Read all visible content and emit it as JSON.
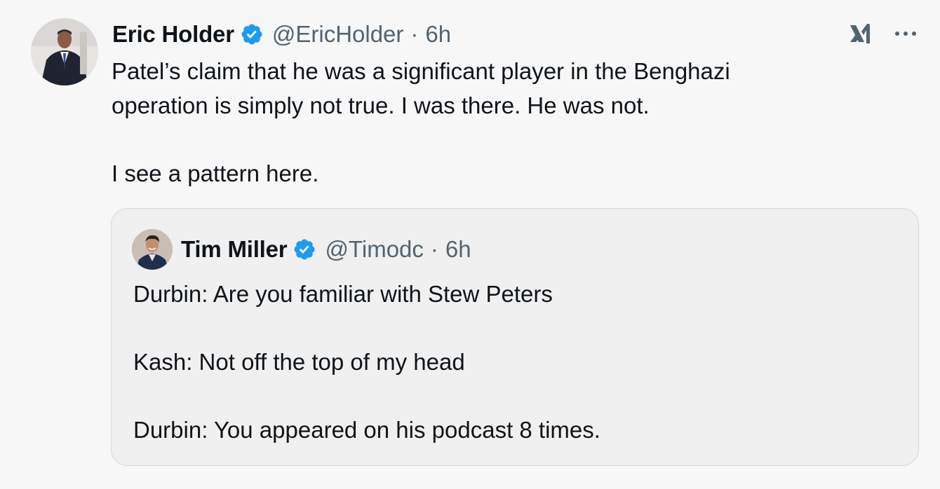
{
  "tweet": {
    "author_name": "Eric Holder",
    "handle": "@EricHolder",
    "separator": "·",
    "time": "6h",
    "verified": true,
    "body": {
      "line1": "Patel’s claim that he was a significant player in the Benghazi",
      "line2": "operation is simply not true.  I was there.  He was not.",
      "line3": "I see a pattern here."
    },
    "actions": {
      "grok_icon": "grok-icon",
      "more_icon": "more-options-icon"
    }
  },
  "quoted_tweet": {
    "author_name": "Tim Miller",
    "handle": "@Timodc",
    "separator": "·",
    "time": "6h",
    "verified": true,
    "lines": [
      "Durbin: Are you familiar with Stew Peters",
      "Kash: Not off the top of my head",
      "Durbin: You appeared on his podcast 8 times."
    ]
  },
  "colors": {
    "background": "#f7f7f7",
    "quote_background": "#f0f0f0",
    "verified_blue": "#1d9bf0",
    "secondary_text": "#536471",
    "primary_text": "#0f1419",
    "border": "#cfd9de"
  }
}
